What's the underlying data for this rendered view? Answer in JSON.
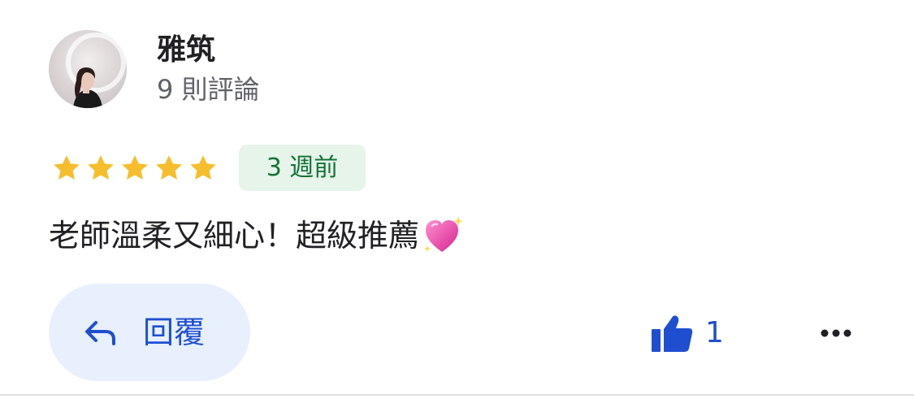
{
  "reviewer": {
    "name": "雅筑",
    "review_count": "9 則評論",
    "avatar_icon": "user-avatar"
  },
  "review": {
    "rating": 5,
    "max_rating": 5,
    "time_ago": "3 週前",
    "text": "老師溫柔又細心！超級推薦",
    "emoji_icon": "sparkling-heart-icon"
  },
  "actions": {
    "reply_label": "回覆",
    "reply_icon": "reply-arrow-icon",
    "like_icon": "thumbs-up-icon",
    "like_count": "1",
    "more_icon": "more-horizontal-icon"
  },
  "colors": {
    "star": "#F6BE2C",
    "badge_bg": "#E6F4EA",
    "badge_text": "#137333",
    "accent": "#1F4FD0",
    "reply_bg": "#E8F0FE"
  }
}
